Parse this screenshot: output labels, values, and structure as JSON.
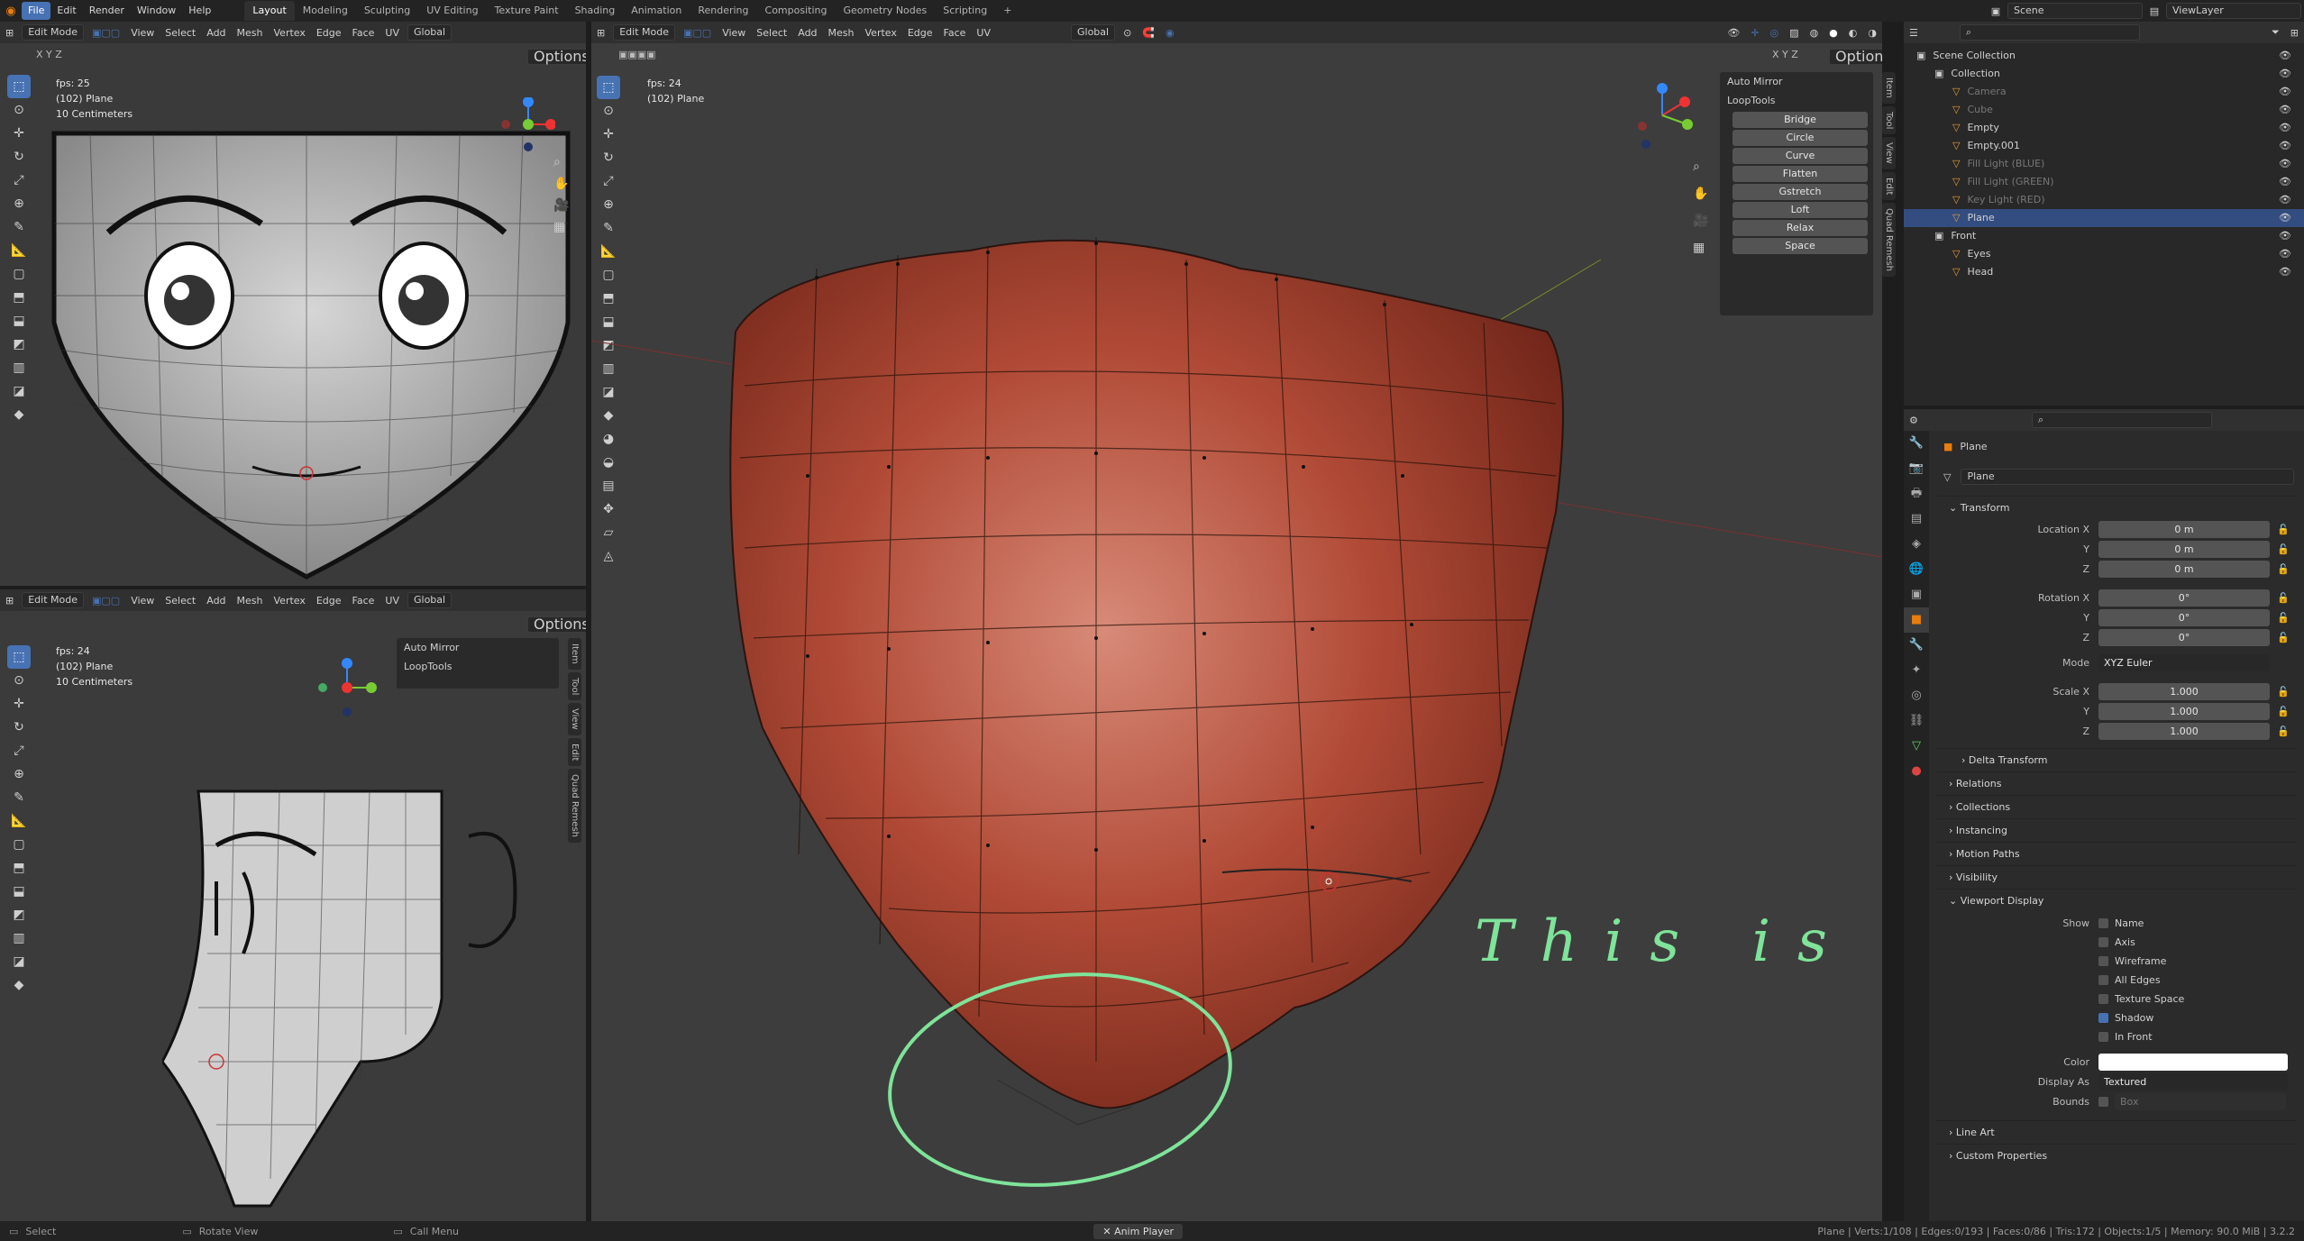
{
  "menu": {
    "items": [
      "File",
      "Edit",
      "Render",
      "Window",
      "Help"
    ],
    "workspaces": [
      "Layout",
      "Modeling",
      "Sculpting",
      "UV Editing",
      "Texture Paint",
      "Shading",
      "Animation",
      "Rendering",
      "Compositing",
      "Geometry Nodes",
      "Scripting"
    ],
    "add_tab": "+",
    "scene": "Scene",
    "view_layer": "ViewLayer"
  },
  "viewport_menu": {
    "mode": "Edit Mode",
    "view": "View",
    "select": "Select",
    "add": "Add",
    "mesh": "Mesh",
    "vertex": "Vertex",
    "edge": "Edge",
    "face": "Face",
    "uv": "UV",
    "orientation": "Global",
    "options": "Options",
    "axes": [
      "X",
      "Y",
      "Z"
    ]
  },
  "viewport_tl": {
    "fps": "fps: 25",
    "object": "(102) Plane",
    "scale": "10 Centimeters"
  },
  "viewport_bl": {
    "fps": "fps: 24",
    "object": "(102) Plane",
    "scale": "10 Centimeters",
    "auto_mirror": "Auto Mirror",
    "looptools": "LoopTools"
  },
  "viewport_main": {
    "fps": "fps: 24",
    "object": "(102) Plane",
    "auto_mirror": "Auto Mirror",
    "looptools": "LoopTools",
    "looptools_buttons": [
      "Bridge",
      "Circle",
      "Curve",
      "Flatten",
      "Gstretch",
      "Loft",
      "Relax",
      "Space"
    ],
    "annotation": "This is okay"
  },
  "side_tabs": [
    "Item",
    "Tool",
    "View",
    "Edit",
    "Quad Remesh"
  ],
  "outliner": {
    "search_placeholder": "",
    "rows": [
      {
        "label": "Scene Collection",
        "indent": 0,
        "dim": false
      },
      {
        "label": "Collection",
        "indent": 1,
        "dim": false
      },
      {
        "label": "Camera",
        "indent": 2,
        "dim": true
      },
      {
        "label": "Cube",
        "indent": 2,
        "dim": true
      },
      {
        "label": "Empty",
        "indent": 2,
        "dim": false
      },
      {
        "label": "Empty.001",
        "indent": 2,
        "dim": false
      },
      {
        "label": "Fill Light (BLUE)",
        "indent": 2,
        "dim": true
      },
      {
        "label": "Fill Light (GREEN)",
        "indent": 2,
        "dim": true
      },
      {
        "label": "Key Light (RED)",
        "indent": 2,
        "dim": true
      },
      {
        "label": "Plane",
        "indent": 2,
        "dim": false,
        "selected": true
      },
      {
        "label": "Front",
        "indent": 1,
        "dim": false
      },
      {
        "label": "Eyes",
        "indent": 2,
        "dim": false
      },
      {
        "label": "Head",
        "indent": 2,
        "dim": false
      }
    ]
  },
  "properties": {
    "object_name": "Plane",
    "data_name": "Plane",
    "transform": "Transform",
    "location_label": "Location X",
    "location": [
      "0 m",
      "0 m",
      "0 m"
    ],
    "rotation_label": "Rotation X",
    "rotation": [
      "0°",
      "0°",
      "0°"
    ],
    "mode_label": "Mode",
    "mode": "XYZ Euler",
    "scale_label": "Scale X",
    "scale": [
      "1.000",
      "1.000",
      "1.000"
    ],
    "axis_y": "Y",
    "axis_z": "Z",
    "delta": "Delta Transform",
    "sections": [
      "Relations",
      "Collections",
      "Instancing",
      "Motion Paths",
      "Visibility"
    ],
    "viewport_display": "Viewport Display",
    "show_label": "Show",
    "show_items": [
      {
        "label": "Name",
        "on": false
      },
      {
        "label": "Axis",
        "on": false
      },
      {
        "label": "Wireframe",
        "on": false
      },
      {
        "label": "All Edges",
        "on": false
      },
      {
        "label": "Texture Space",
        "on": false
      },
      {
        "label": "Shadow",
        "on": true
      },
      {
        "label": "In Front",
        "on": false
      }
    ],
    "color_label": "Color",
    "display_as_label": "Display As",
    "display_as": "Textured",
    "bounds_label": "Bounds",
    "bounds": "Box",
    "bottom_sections": [
      "Line Art",
      "Custom Properties"
    ]
  },
  "status": {
    "select": "Select",
    "rotate": "Rotate View",
    "menu": "Call Menu",
    "anim_player": "Anim Player",
    "stats": "Plane | Verts:1/108 | Edges:0/193 | Faces:0/86 | Tris:172 | Objects:1/5 | Memory: 90.0 MiB | 3.2.2"
  },
  "colors": {
    "accent": "#4772b3",
    "mesh": "#b04a36",
    "annotation": "#7fe39a"
  }
}
